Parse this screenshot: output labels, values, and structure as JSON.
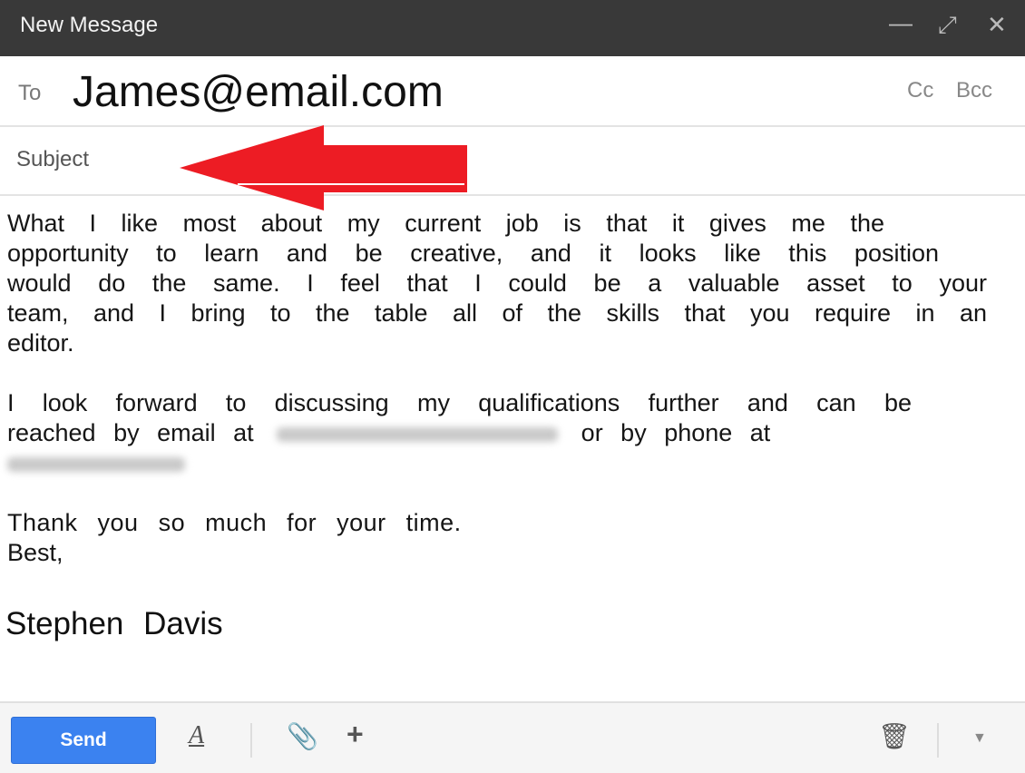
{
  "window": {
    "title": "New Message",
    "minimize_icon": "minimize-icon",
    "expand_icon": "expand-icon",
    "close_icon": "close-icon"
  },
  "to": {
    "label": "To",
    "value": "James@email.com",
    "cc": "Cc",
    "bcc": "Bcc"
  },
  "subject": {
    "placeholder": "Subject"
  },
  "annotation": {
    "arrow_color": "#ED1C24",
    "arrow_direction": "left",
    "points_to": "subject"
  },
  "body": {
    "p1": [
      "What I like most about my current job is that it gives me the",
      "opportunity to learn and be creative, and it looks like this position",
      "would do the same. I feel that I could be a valuable asset to your",
      "team, and I bring to the table all of the skills that you require in an",
      "editor."
    ],
    "p2": {
      "line1": "I look forward to discussing my qualifications further and can be",
      "line2_start": "reached by email at",
      "line2_end": "or by phone at"
    },
    "p3": [
      "Thank you so much for your time.",
      "Best,"
    ],
    "signature": "Stephen  Davis"
  },
  "footer": {
    "send": "Send",
    "send_color": "#3B82F0",
    "icons": [
      "text-format-icon",
      "attach-icon",
      "plus-icon",
      "trash-icon",
      "dropdown-arrow-icon"
    ]
  }
}
